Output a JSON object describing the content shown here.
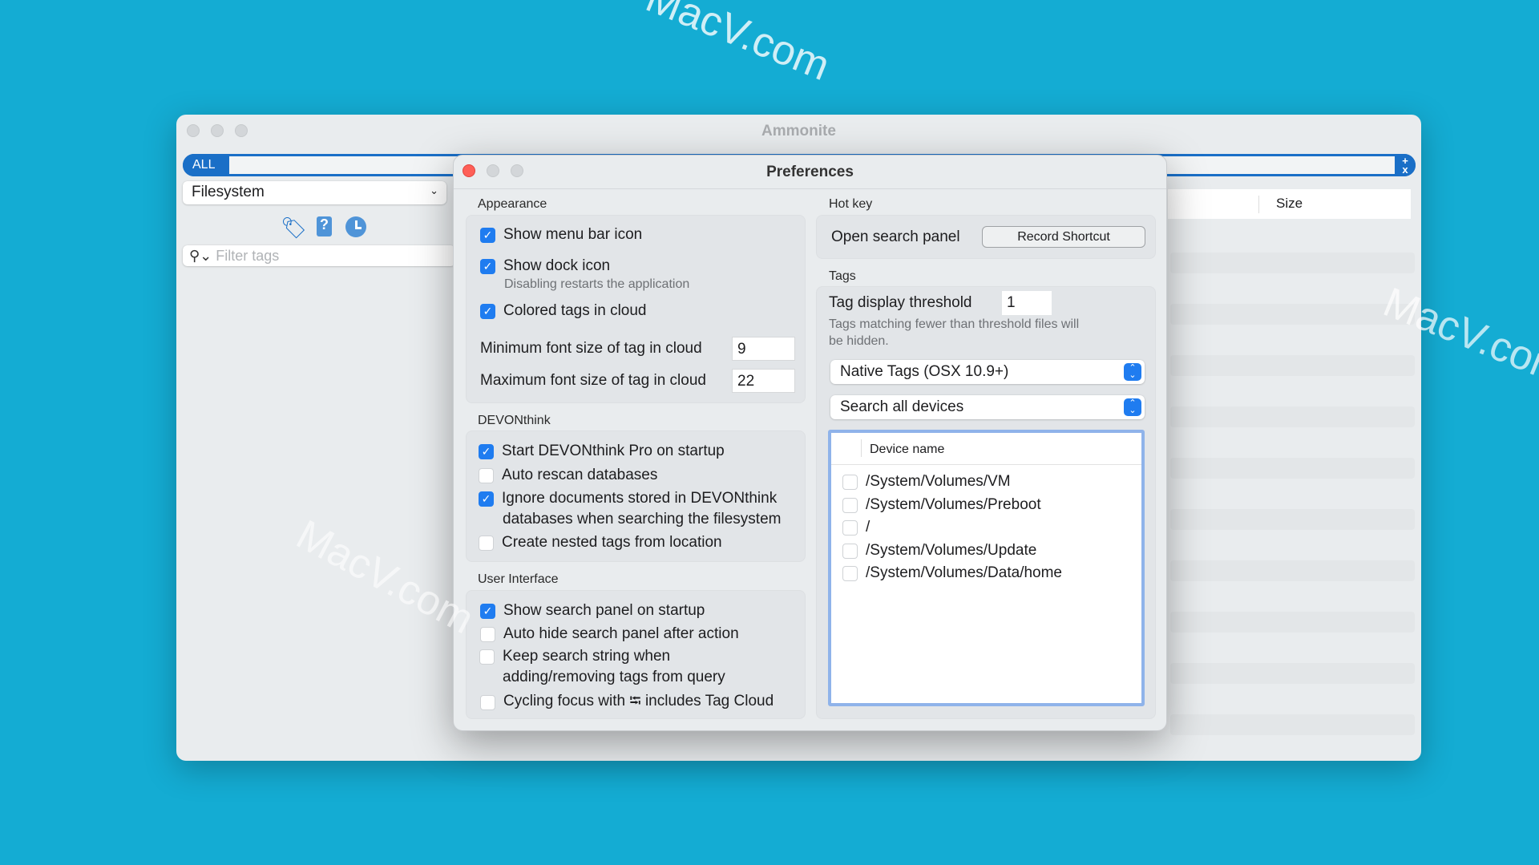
{
  "watermark": "MacV.com",
  "main_window": {
    "title": "Ammonite",
    "search": {
      "scope_label": "ALL",
      "clear_label": "+\nx"
    },
    "source_select": {
      "value": "Filesystem"
    },
    "toolbar_icons": [
      "tag-icon",
      "untagged-file-icon",
      "recent-clock-icon"
    ],
    "filter": {
      "placeholder": "Filter tags"
    },
    "table": {
      "columns": [
        "Size"
      ]
    }
  },
  "preferences": {
    "title": "Preferences",
    "appearance": {
      "label": "Appearance",
      "show_menu_bar_icon": {
        "label": "Show menu bar icon",
        "checked": true
      },
      "show_dock_icon": {
        "label": "Show dock icon",
        "checked": true,
        "hint": "Disabling restarts the application"
      },
      "colored_tags": {
        "label": "Colored tags in cloud",
        "checked": true
      },
      "min_font": {
        "label": "Minimum font size of tag in cloud",
        "value": "9"
      },
      "max_font": {
        "label": "Maximum font size of tag in cloud",
        "value": "22"
      }
    },
    "devonthink": {
      "label": "DEVONthink",
      "start": {
        "label": "Start DEVONthink Pro on startup",
        "checked": true
      },
      "rescan": {
        "label": "Auto rescan databases",
        "checked": false
      },
      "ignore": {
        "label": "Ignore documents stored in DEVONthink",
        "label2": "databases when searching the filesystem",
        "checked": true
      },
      "nested": {
        "label": "Create nested tags from location",
        "checked": false
      }
    },
    "ui": {
      "label": "User Interface",
      "show_panel": {
        "label": "Show search panel on startup",
        "checked": true
      },
      "auto_hide": {
        "label": "Auto hide search panel after action",
        "checked": false
      },
      "keep_string": {
        "label": "Keep search string when",
        "label2": "adding/removing tags from query",
        "checked": false
      },
      "cycling": {
        "label": "Cycling focus with ⭾ includes Tag Cloud",
        "checked": false
      }
    },
    "hotkey": {
      "label": "Hot key",
      "open_label": "Open search panel",
      "button": "Record Shortcut"
    },
    "tags": {
      "label": "Tags",
      "threshold_label": "Tag display threshold",
      "threshold_value": "1",
      "hint1": "Tags matching fewer than threshold files will",
      "hint2": "be hidden.",
      "tag_type": "Native Tags (OSX 10.9+)",
      "device_scope": "Search all devices",
      "device_header": "Device name",
      "devices": [
        {
          "name": "/System/Volumes/VM",
          "checked": false
        },
        {
          "name": "/System/Volumes/Preboot",
          "checked": false
        },
        {
          "name": "/",
          "checked": false
        },
        {
          "name": "/System/Volumes/Update",
          "checked": false
        },
        {
          "name": "/System/Volumes/Data/home",
          "checked": false
        }
      ]
    }
  },
  "colors": {
    "background": "#14acd3",
    "accent": "#1f7cf0",
    "search_border": "#1a6fc7",
    "close": "#fe5f57"
  }
}
